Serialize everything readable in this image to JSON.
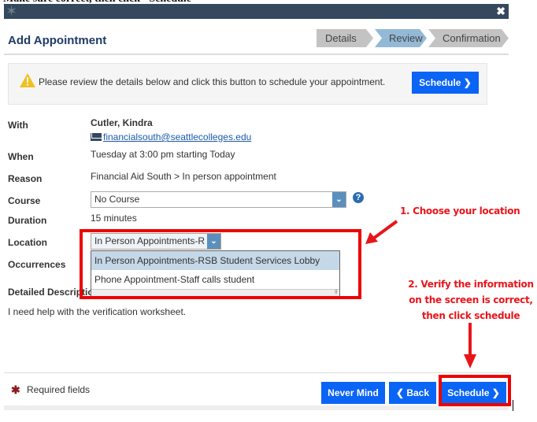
{
  "top_cut_text": "Make sure correct, then click \"Schedule\"",
  "window": {
    "close_label": "✖",
    "logo_icon": "star-logo-icon"
  },
  "header": {
    "title": "Add Appointment"
  },
  "steps": [
    {
      "label": "Details",
      "active": false
    },
    {
      "label": "Review",
      "active": true
    },
    {
      "label": "Confirmation",
      "active": false
    }
  ],
  "notice": {
    "message": "Please review the details below and click this button to schedule your appointment.",
    "button_label": "Schedule ❯"
  },
  "fields": {
    "with_label": "With",
    "with_name": "Cutler, Kindra",
    "with_email": "financialsouth@seattlecolleges.edu",
    "when_label": "When",
    "when_value": "Tuesday at 3:00 pm starting Today",
    "reason_label": "Reason",
    "reason_value": "Financial Aid South > In person appointment",
    "course_label": "Course",
    "course_value": "No Course",
    "help_label": "?",
    "duration_label": "Duration",
    "duration_value": "15 minutes",
    "location_label": "Location",
    "location_value": "In Person Appointments-R",
    "occurrences_label": "Occurrences",
    "description_label": "Detailed Description",
    "description_value": "I need help with the verification worksheet."
  },
  "location_options": [
    {
      "label": "In Person Appointments-RSB Student Services Lobby",
      "selected": true
    },
    {
      "label": "Phone Appointment-Staff calls student",
      "selected": false
    }
  ],
  "annotations": {
    "note1": "1. Choose your location",
    "note2_line1": "2. Verify the information",
    "note2_line2": "on the screen is correct,",
    "note2_line3": "then click schedule",
    "color": "#e8151b"
  },
  "footer": {
    "required_star": "✱",
    "required_text": "Required fields",
    "never_mind_label": "Never Mind",
    "back_label": "❮ Back",
    "schedule_label": "Schedule ❯"
  },
  "colors": {
    "titlebar": "#34495e",
    "primary_button": "#0a64f5",
    "active_step": "#93b9d6",
    "inactive_step": "#c3c3c3",
    "highlight_box": "#ee0000"
  }
}
